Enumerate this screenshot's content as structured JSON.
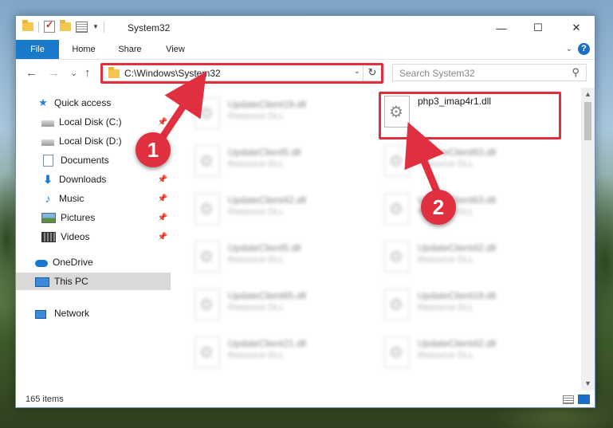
{
  "window": {
    "title": "System32",
    "controls": {
      "minimize": "—",
      "maximize": "☐",
      "close": "✕"
    }
  },
  "ribbon": {
    "tabs": [
      {
        "label": "File"
      },
      {
        "label": "Home"
      },
      {
        "label": "Share"
      },
      {
        "label": "View"
      }
    ],
    "help": "?"
  },
  "nav": {
    "back": "←",
    "forward": "→",
    "recent": "⌄",
    "up": "↑",
    "address": "C:\\Windows\\System32",
    "refresh": "↻",
    "search_placeholder": "Search System32"
  },
  "sidebar": {
    "items": [
      {
        "label": "Quick access",
        "icon": "star-icon",
        "pinned": false
      },
      {
        "label": "Local Disk (C:)",
        "icon": "disk-icon",
        "pinned": true
      },
      {
        "label": "Local Disk (D:)",
        "icon": "disk-icon",
        "pinned": true
      },
      {
        "label": "Documents",
        "icon": "documents-icon",
        "pinned": true
      },
      {
        "label": "Downloads",
        "icon": "download-icon",
        "pinned": true
      },
      {
        "label": "Music",
        "icon": "music-icon",
        "pinned": true
      },
      {
        "label": "Pictures",
        "icon": "pictures-icon",
        "pinned": true
      },
      {
        "label": "Videos",
        "icon": "videos-icon",
        "pinned": true
      },
      {
        "label": "OneDrive",
        "icon": "onedrive-icon",
        "pinned": false
      },
      {
        "label": "This PC",
        "icon": "this-pc-icon",
        "pinned": false,
        "selected": true
      },
      {
        "label": "Network",
        "icon": "network-icon",
        "pinned": false
      }
    ]
  },
  "files": [
    {
      "name": "UpdateClient19.dll",
      "type": "Resource DLL",
      "blurred": true
    },
    {
      "name": "php3_imap4r1.dll",
      "type": "",
      "blurred": false,
      "highlighted": true
    },
    {
      "name": "UpdateClient5.dll",
      "type": "Resource DLL",
      "blurred": true
    },
    {
      "name": "UpdateClient63.dll",
      "type": "Resource DLL",
      "blurred": true
    },
    {
      "name": "UpdateClient42.dll",
      "type": "Resource DLL",
      "blurred": true
    },
    {
      "name": "UpdateClient63.dll",
      "type": "Resource DLL",
      "blurred": true
    },
    {
      "name": "UpdateClient5.dll",
      "type": "Resource DLL",
      "blurred": true
    },
    {
      "name": "UpdateClient42.dll",
      "type": "Resource DLL",
      "blurred": true
    },
    {
      "name": "UpdateClient65.dll",
      "type": "Resource DLL",
      "blurred": true
    },
    {
      "name": "UpdateClient19.dll",
      "type": "Resource DLL",
      "blurred": true
    },
    {
      "name": "UpdateClient21.dll",
      "type": "Resource DLL",
      "blurred": true
    },
    {
      "name": "UpdateClient42.dll",
      "type": "Resource DLL",
      "blurred": true
    }
  ],
  "status": {
    "count_text": "165 items"
  },
  "annotations": {
    "step1": "1",
    "step2": "2",
    "color": "#e03040"
  }
}
